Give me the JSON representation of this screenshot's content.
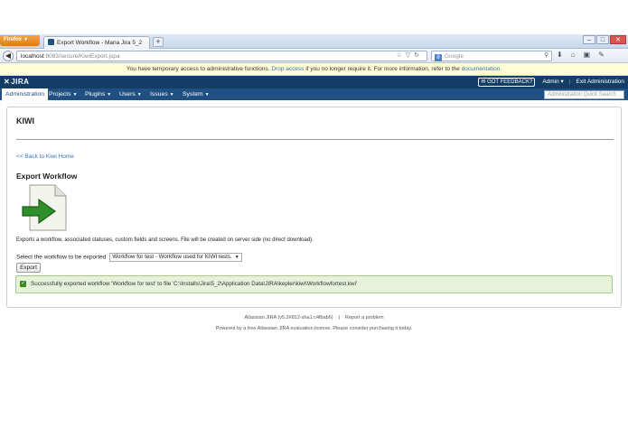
{
  "browser": {
    "app_button": "Firefox",
    "tab_title": "Export Workflow - Maria Jira 5_2",
    "new_tab": "+",
    "url_host": "localhost",
    "url_rest": ":8083/secure/KiwiExport.jspa",
    "search_placeholder": "Google",
    "search_engine_letter": "8",
    "window_controls": [
      "–",
      "□",
      "✕"
    ]
  },
  "notice": {
    "text_before": "You have temporary access to administrative functions.",
    "link1": "Drop access",
    "text_middle": "if you no longer require it. For more information, refer to the",
    "link2": "documentation",
    "text_after": "."
  },
  "header": {
    "logo": "JIRA",
    "feedback": "GOT FEEDBACK?",
    "user": "Admin",
    "exit": "Exit Administration"
  },
  "menu": {
    "items": [
      {
        "label": "Administration"
      },
      {
        "label": "Projects"
      },
      {
        "label": "Plugins"
      },
      {
        "label": "Users"
      },
      {
        "label": "Issues"
      },
      {
        "label": "System"
      }
    ],
    "quick_search_placeholder": "Administration Quick Search"
  },
  "content": {
    "title": "KIWI",
    "back_link": "<< Back to Kiwi Home",
    "section_title": "Export Workflow",
    "description": "Exports a workflow, associated statuses, custom fields and screens. File will be created on server side (no direct download).",
    "select_label": "Select the workflow to be exported",
    "select_value": "Workflow for test - Workflow used for KIWI tests.",
    "export_button": "Export",
    "success_message": "Successfully exported workflow 'Workflow for test' to file 'C:\\Installs\\Jira\\5_2\\Application Data\\JIRA\\kepler\\kiwi\\Workflowfortest.kwi'"
  },
  "footer": {
    "version": "Atlassian JIRA (v5.2#812-sha1:c4fbab6)",
    "report": "Report a problem",
    "license": "Powered by a free Atlassian JIRA evaluation license. Please consider purchasing it today."
  }
}
